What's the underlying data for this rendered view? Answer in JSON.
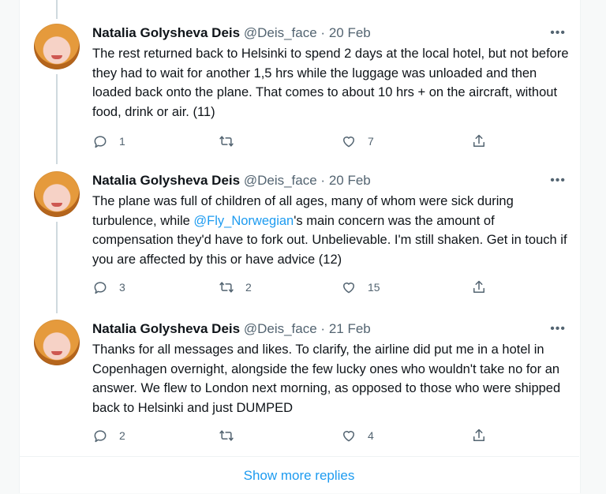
{
  "colors": {
    "accent": "#1d9bf0",
    "text": "#0f1419",
    "muted": "#536471"
  },
  "tweets": [
    {
      "name": "Natalia Golysheva Deis",
      "handle": "@Deis_face",
      "separator": "·",
      "date": "20 Feb",
      "text": "The rest returned back to Helsinki to spend 2 days at the local hotel, but not before they had to wait for another 1,5 hrs while the luggage was unloaded and then loaded back onto the plane. That comes to about 10 hrs + on the aircraft, without food, drink or air. (11)",
      "reply_count": "1",
      "retweet_count": "",
      "like_count": "7"
    },
    {
      "name": "Natalia Golysheva Deis",
      "handle": "@Deis_face",
      "separator": "·",
      "date": "20 Feb",
      "text_before": "The plane was full of children of all ages, many of whom were sick during turbulence, while ",
      "mention": "@Fly_Norwegian",
      "text_after": "'s main concern was the amount of compensation they'd have to fork out. Unbelievable. I'm still shaken. Get in touch if you are affected by this or have advice (12)",
      "reply_count": "3",
      "retweet_count": "2",
      "like_count": "15"
    },
    {
      "name": "Natalia Golysheva Deis",
      "handle": "@Deis_face",
      "separator": "·",
      "date": "21 Feb",
      "text": "Thanks for all messages and likes. To clarify, the airline did put me in a hotel in Copenhagen overnight, alongside the few lucky ones who wouldn't take no for an answer. We flew to London next morning, as opposed to those who were shipped back to Helsinki and just DUMPED",
      "reply_count": "2",
      "retweet_count": "",
      "like_count": "4"
    }
  ],
  "show_more_label": "Show more replies",
  "more_glyph": "•••"
}
